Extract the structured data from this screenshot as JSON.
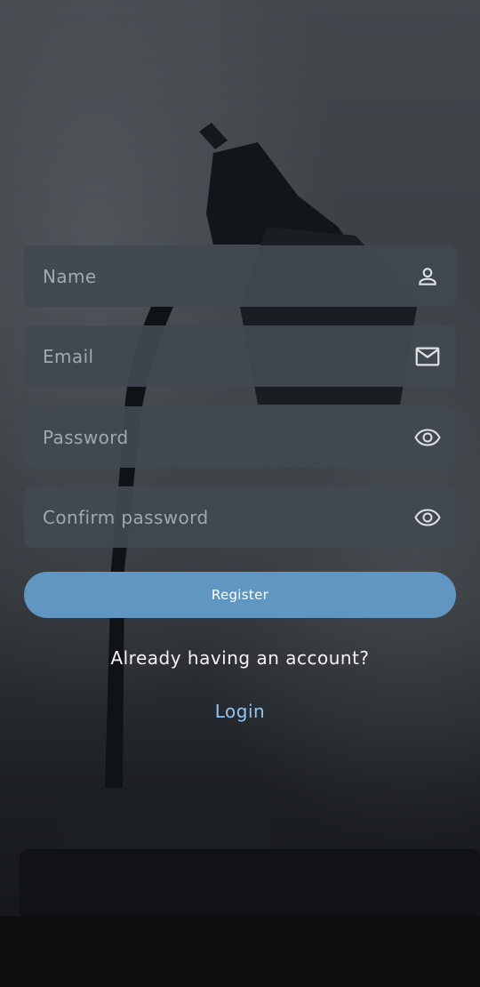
{
  "form": {
    "name": {
      "placeholder": "Name",
      "icon": "person-icon"
    },
    "email": {
      "placeholder": "Email",
      "icon": "mail-icon"
    },
    "password": {
      "placeholder": "Password",
      "icon": "eye-icon"
    },
    "confirm_password": {
      "placeholder": "Confirm password",
      "icon": "eye-icon"
    }
  },
  "register_label": "Register",
  "account_prompt": "Already having an account?",
  "login_label": "Login",
  "colors": {
    "field_bg": "#424850",
    "button_bg": "#6196c2",
    "link": "#8ec6f2",
    "placeholder": "#a3a8ae"
  }
}
